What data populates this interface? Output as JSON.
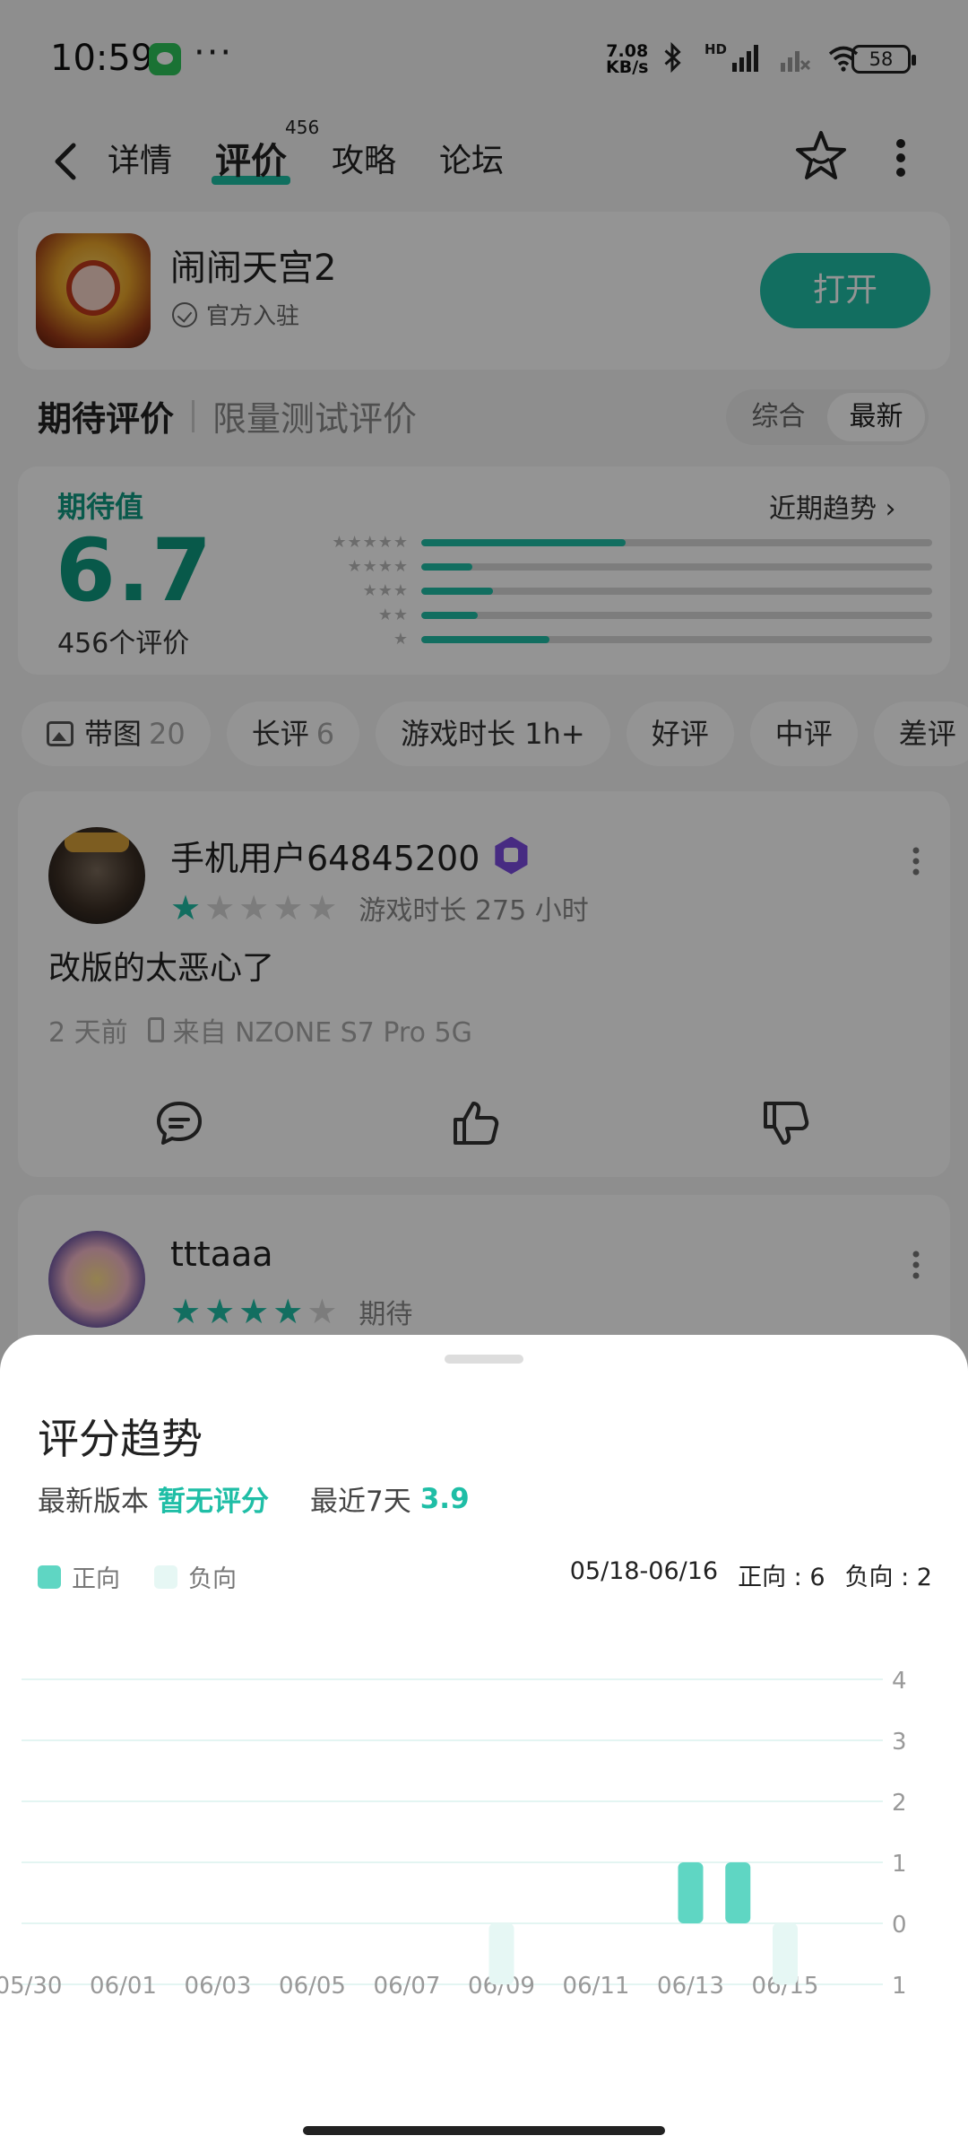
{
  "status_bar": {
    "time": "10:59",
    "net_speed_value": "7.08",
    "net_speed_unit": "KB/s",
    "battery": "58",
    "hd_label": "HD",
    "icons": [
      "wechat-icon",
      "more-dots-icon",
      "bluetooth-icon",
      "signal-icon",
      "signal-off-icon",
      "wifi-icon",
      "battery-icon"
    ]
  },
  "nav": {
    "tabs": [
      {
        "label": "详情"
      },
      {
        "label": "评价",
        "badge": "456"
      },
      {
        "label": "攻略"
      },
      {
        "label": "论坛"
      }
    ],
    "active_tab": "评价"
  },
  "app": {
    "name": "闹闹天宫2",
    "official_label": "官方入驻",
    "open_button": "打开"
  },
  "section": {
    "active": "期待评价",
    "inactive": "限量测试评价",
    "sort_options": [
      "综合",
      "最新"
    ],
    "sort_selected": "最新"
  },
  "rating": {
    "label": "期待值",
    "value": "6.7",
    "count_text": "456个评价",
    "trend_link": "近期趋势 ›",
    "distribution": [
      {
        "stars": 5,
        "fraction": 0.4
      },
      {
        "stars": 4,
        "fraction": 0.1
      },
      {
        "stars": 3,
        "fraction": 0.14
      },
      {
        "stars": 2,
        "fraction": 0.11
      },
      {
        "stars": 1,
        "fraction": 0.25
      }
    ]
  },
  "filters": [
    {
      "label": "带图",
      "count": "20",
      "icon": "image-icon"
    },
    {
      "label": "长评",
      "count": "6"
    },
    {
      "label": "游戏时长 1h+",
      "count": ""
    },
    {
      "label": "好评",
      "count": ""
    },
    {
      "label": "中评",
      "count": ""
    },
    {
      "label": "差评",
      "count": ""
    }
  ],
  "reviews": [
    {
      "user": "手机用户64845200",
      "rating": 1,
      "meta": "游戏时长 275 小时",
      "content": "改版的太恶心了",
      "time": "2 天前",
      "device": "来自 NZONE S7 Pro 5G"
    },
    {
      "user": "tttaaa",
      "rating": 4,
      "meta": "期待"
    }
  ],
  "sheet": {
    "title": "评分趋势",
    "latest_version_label": "最新版本",
    "latest_version_value": "暂无评分",
    "recent_label": "最近7天",
    "recent_value": "3.9",
    "legend_positive": "正向",
    "legend_negative": "负向",
    "date_range": "05/18-06/16",
    "positive_summary": "正向 : 6",
    "negative_summary": "负向 : 2"
  },
  "colors": {
    "accent": "#1fbea6",
    "positive": "#5fd6c3",
    "negative": "#e6f7f4"
  },
  "chart_data": {
    "type": "bar",
    "x_labels": [
      "05/30",
      "06/01",
      "06/03",
      "06/05",
      "06/07",
      "06/09",
      "06/11",
      "06/13",
      "06/15"
    ],
    "y_ticks": [
      "4",
      "3",
      "2",
      "1",
      "0",
      "1"
    ],
    "ylim": [
      -1,
      4
    ],
    "series": [
      {
        "name": "正向",
        "points": [
          {
            "x": "06/13",
            "y": 1
          },
          {
            "x": "06/14",
            "y": 1
          }
        ]
      },
      {
        "name": "负向",
        "points": [
          {
            "x": "06/09",
            "y": -1
          },
          {
            "x": "06/15",
            "y": -1
          }
        ]
      }
    ]
  }
}
